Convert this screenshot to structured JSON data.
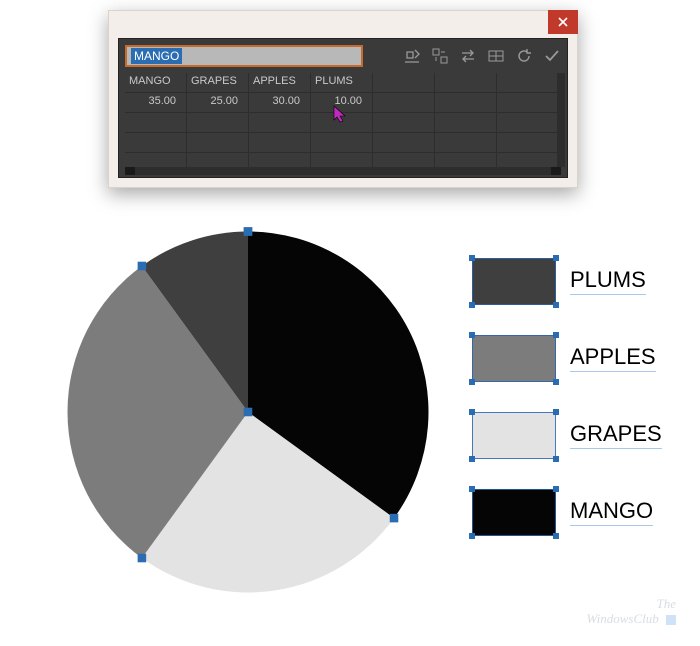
{
  "panel": {
    "input_value": "MANGO",
    "headers": [
      "MANGO",
      "GRAPES",
      "APPLES",
      "PLUMS"
    ],
    "values": [
      "35.00",
      "25.00",
      "30.00",
      "10.00"
    ]
  },
  "chart_data": {
    "type": "pie",
    "title": "",
    "series": [
      {
        "name": "MANGO",
        "value": 35.0,
        "color": "#050505"
      },
      {
        "name": "GRAPES",
        "value": 25.0,
        "color": "#e3e3e3"
      },
      {
        "name": "APPLES",
        "value": 30.0,
        "color": "#7c7c7c"
      },
      {
        "name": "PLUMS",
        "value": 10.0,
        "color": "#3f3f3f"
      }
    ]
  },
  "legend": [
    {
      "label": "PLUMS",
      "color": "#3f3f3f"
    },
    {
      "label": "APPLES",
      "color": "#7c7c7c"
    },
    {
      "label": "GRAPES",
      "color": "#e3e3e3"
    },
    {
      "label": "MANGO",
      "color": "#050505"
    }
  ],
  "watermark": {
    "line1": "The",
    "line2": "WindowsClub"
  }
}
